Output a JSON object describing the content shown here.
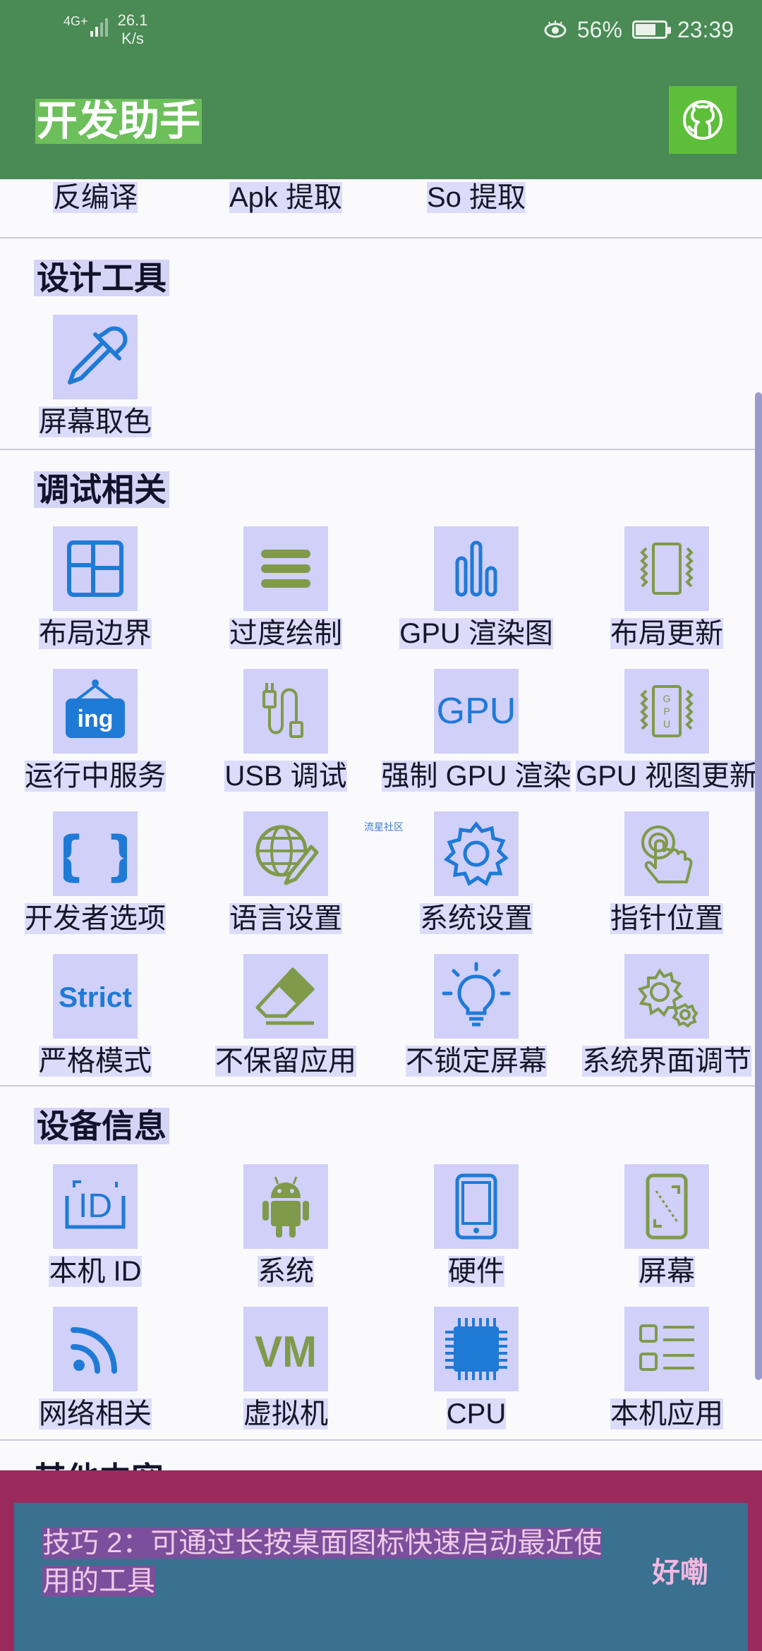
{
  "status_bar": {
    "network": "4G+",
    "speed_value": "26.1",
    "speed_unit": "K/s",
    "battery": "56%",
    "time": "23:39"
  },
  "app_bar": {
    "title": "开发助手",
    "github_icon": "github-icon"
  },
  "sections": {
    "top_row": [
      "反编译",
      "Apk 提取",
      "So 提取"
    ],
    "design": {
      "title": "设计工具",
      "items": [
        "屏幕取色"
      ]
    },
    "debug": {
      "title": "调试相关",
      "items": [
        "布局边界",
        "过度绘制",
        "GPU 渲染图",
        "布局更新",
        "运行中服务",
        "USB 调试",
        "强制 GPU 渲染",
        "GPU 视图更新",
        "开发者选项",
        "语言设置",
        "系统设置",
        "指针位置",
        "严格模式",
        "不保留应用",
        "不锁定屏幕",
        "系统界面调节"
      ]
    },
    "device": {
      "title": "设备信息",
      "items": [
        "本机 ID",
        "系统",
        "硬件",
        "屏幕",
        "网络相关",
        "虚拟机",
        "CPU",
        "本机应用"
      ]
    },
    "next_partial": {
      "title": "其他内容"
    }
  },
  "watermark": "流星社区",
  "tip_banner": {
    "message": "技巧 2：可通过长按桌面图标快速启动最近使用的工具",
    "ok_label": "好嘞"
  },
  "colors": {
    "green": "#4a8a55",
    "tile_bg": "#d0d0f9",
    "icon_blue": "#1f7ad6",
    "icon_olive": "#7f9a4a",
    "banner_magenta": "#9a2a5c",
    "banner_card": "#3a7090"
  }
}
